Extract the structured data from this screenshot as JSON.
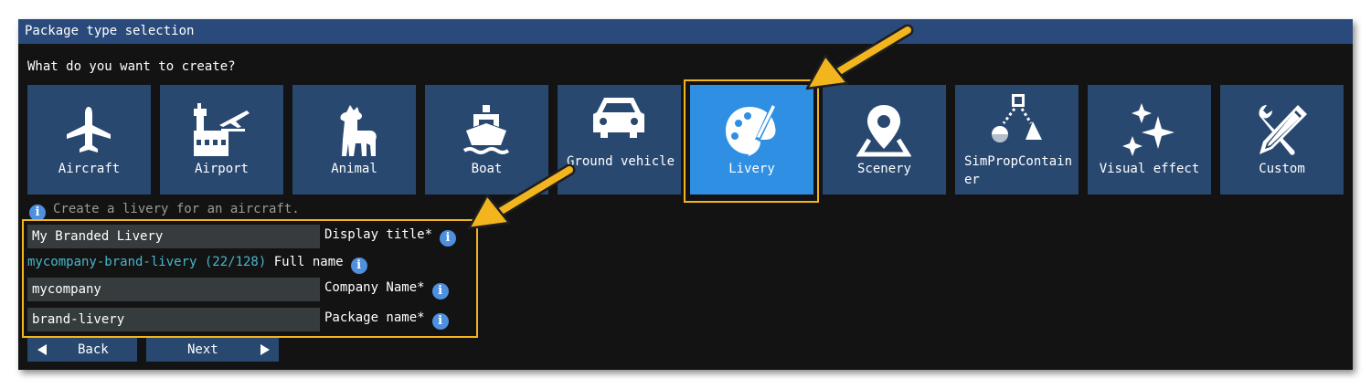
{
  "window": {
    "title": "Package type selection"
  },
  "question": "What do you want to create?",
  "tiles": [
    {
      "label": "Aircraft",
      "icon": "aircraft-icon"
    },
    {
      "label": "Airport",
      "icon": "airport-icon"
    },
    {
      "label": "Animal",
      "icon": "llama-icon"
    },
    {
      "label": "Boat",
      "icon": "ship-icon"
    },
    {
      "label": "Ground vehicle",
      "icon": "car-icon"
    },
    {
      "label": "Livery",
      "icon": "palette-icon",
      "selected": true
    },
    {
      "label": "Scenery",
      "icon": "map-pin-icon"
    },
    {
      "label": "SimPropContainer",
      "icon": "shapes-icon"
    },
    {
      "label": "Visual effect",
      "icon": "sparkles-icon"
    },
    {
      "label": "Custom",
      "icon": "tools-icon"
    }
  ],
  "hint": "Create a livery for an aircraft.",
  "form": {
    "display_title": {
      "value": "My Branded Livery",
      "label": "Display title*"
    },
    "full_name": {
      "value": "mycompany-brand-livery (22/128)",
      "label": "Full name"
    },
    "company_name": {
      "value": "mycompany",
      "label": "Company Name*"
    },
    "package_name": {
      "value": "brand-livery",
      "label": "Package name*"
    }
  },
  "buttons": {
    "back": "Back",
    "next": "Next"
  },
  "colors": {
    "titlebar": "#2b4a7c",
    "tile": "#294870",
    "tile_selected": "#2f8fe3",
    "highlight": "#f2b51d",
    "background": "#131313"
  }
}
